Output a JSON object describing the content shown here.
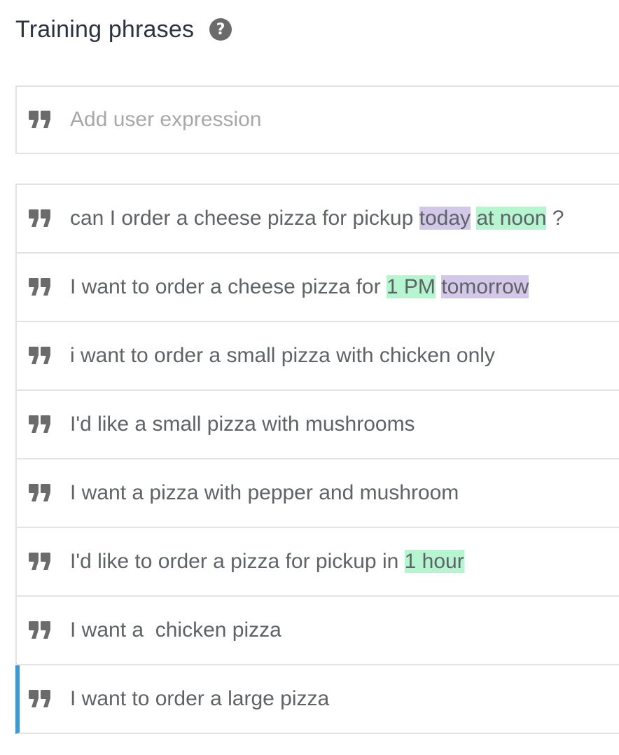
{
  "header": {
    "title": "Training phrases",
    "help_icon": "question-circle-icon"
  },
  "add_expression": {
    "placeholder": "Add user expression",
    "value": "",
    "icon": "quote-icon"
  },
  "colors": {
    "quote_icon": "#6b6b6b",
    "highlight_purple": "#d3c8e8",
    "highlight_green": "#b5f5cf",
    "selected_accent": "#3a9ad9",
    "border": "#e3e3e3"
  },
  "phrases": [
    {
      "segments": [
        {
          "text": "can I order a cheese pizza for pickup ",
          "hl": ""
        },
        {
          "text": "today",
          "hl": "purple"
        },
        {
          "text": " ",
          "hl": ""
        },
        {
          "text": "at noon",
          "hl": "green"
        },
        {
          "text": " ?",
          "hl": ""
        }
      ]
    },
    {
      "segments": [
        {
          "text": "I want to order a cheese pizza for ",
          "hl": ""
        },
        {
          "text": "1 PM",
          "hl": "green"
        },
        {
          "text": " ",
          "hl": ""
        },
        {
          "text": "tomorrow",
          "hl": "purple"
        }
      ]
    },
    {
      "segments": [
        {
          "text": "i want to order a small pizza with chicken only",
          "hl": ""
        }
      ]
    },
    {
      "segments": [
        {
          "text": "I'd like a small pizza with mushrooms",
          "hl": ""
        }
      ]
    },
    {
      "segments": [
        {
          "text": "I want a pizza with pepper and mushroom",
          "hl": ""
        }
      ]
    },
    {
      "segments": [
        {
          "text": "I'd like to order a pizza for pickup in ",
          "hl": ""
        },
        {
          "text": "1 hour",
          "hl": "green"
        }
      ]
    },
    {
      "segments": [
        {
          "text": "I want a  chicken pizza",
          "hl": ""
        }
      ]
    },
    {
      "selected": true,
      "segments": [
        {
          "text": "I want to order a large pizza",
          "hl": ""
        }
      ]
    }
  ]
}
